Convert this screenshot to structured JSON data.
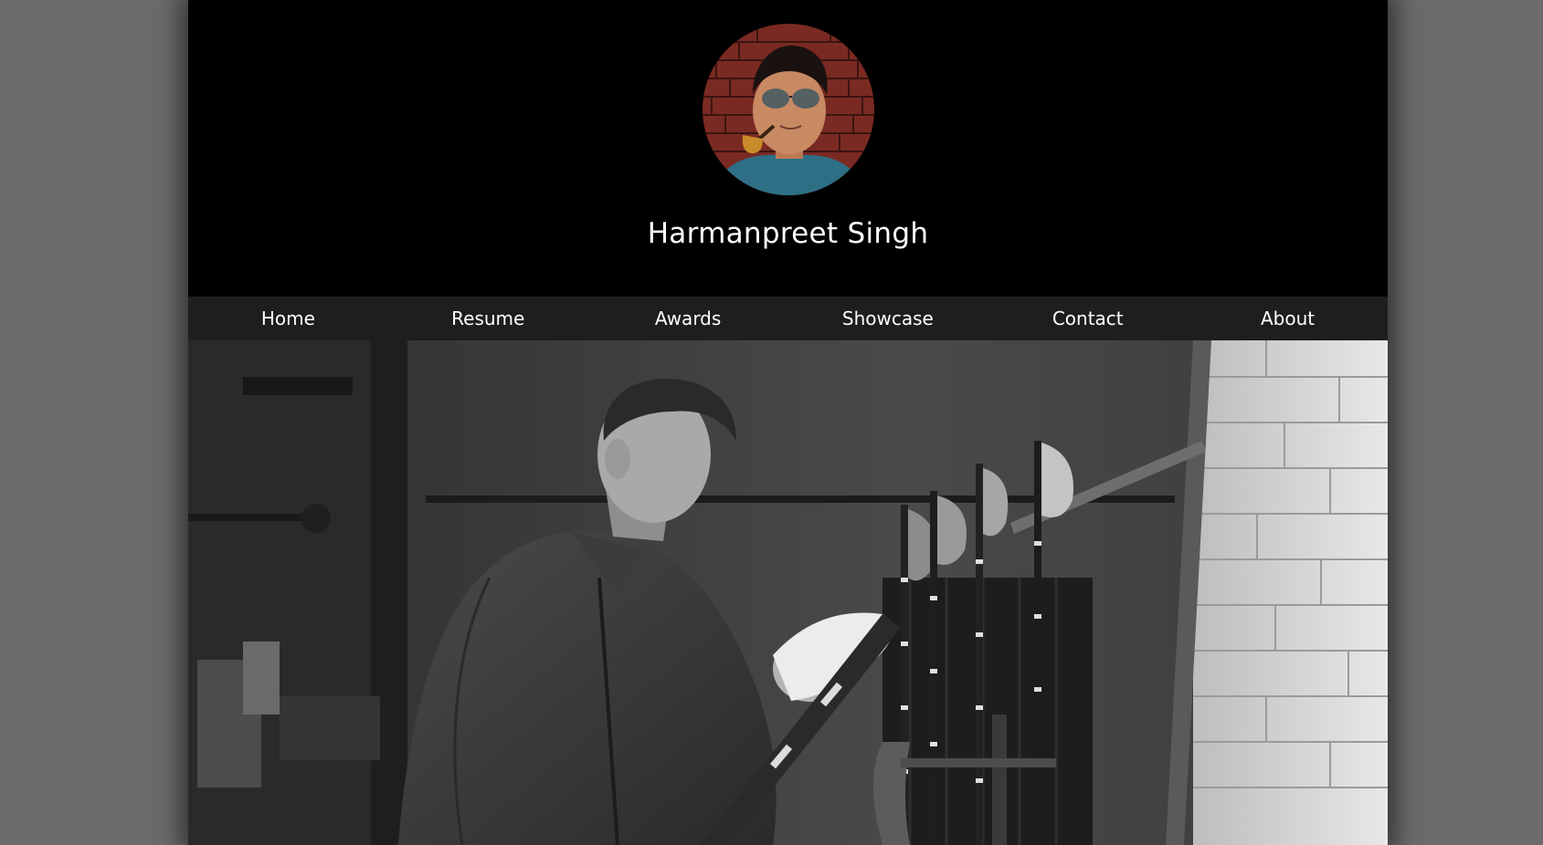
{
  "profile": {
    "name": "Harmanpreet Singh",
    "avatar_icon": "profile-photo"
  },
  "nav": {
    "items": [
      {
        "label": "Home"
      },
      {
        "label": "Resume"
      },
      {
        "label": "Awards"
      },
      {
        "label": "Showcase"
      },
      {
        "label": "Contact"
      },
      {
        "label": "About"
      }
    ]
  },
  "hero": {
    "image": "black-and-white photo of a man holding a ceremonial axe in a workshop"
  },
  "colors": {
    "page_bg": "#6b6b6b",
    "header_bg": "#000000",
    "nav_bg": "#1e1e1e",
    "text": "#ffffff"
  }
}
